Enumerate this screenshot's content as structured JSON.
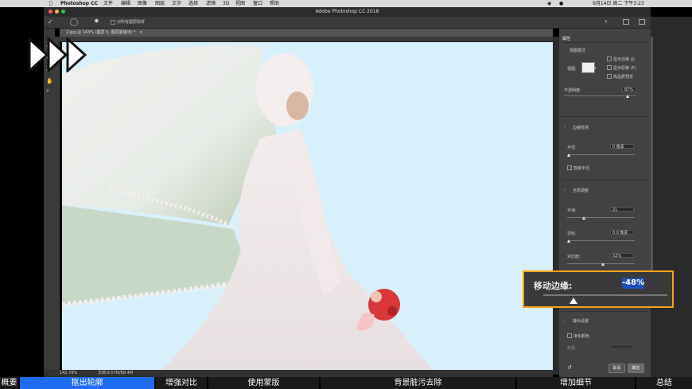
{
  "menubar": {
    "app_name": "Photoshop CC",
    "menus": [
      "文件",
      "编辑",
      "图像",
      "图层",
      "文字",
      "选择",
      "滤镜",
      "3D",
      "视图",
      "窗口",
      "帮助"
    ],
    "clock": "9月14日 周二 下午3:23"
  },
  "window": {
    "title": "Adobe Photoshop CC 2018"
  },
  "options_bar": {
    "sample_all_layers": "对所有图层取样"
  },
  "document_tab": {
    "label": "2.jpg @ 143% (图层 0, 图层蒙版/8) *",
    "close": "×"
  },
  "status": {
    "zoom": "142.78%",
    "doc_size": "文档:9.57M/68.4M"
  },
  "panel": {
    "header": "属性",
    "view_mode": {
      "title": "视图模式",
      "view_label": "视图:",
      "show_edge": "显示边缘 (J)",
      "show_original": "显示原稿 (P)",
      "hq_preview": "高品质预览"
    },
    "opacity": {
      "label": "不透明度:",
      "value": "87%",
      "level": 0.87
    },
    "edge_detection": {
      "title": "边缘检测",
      "radius_label": "半径:",
      "radius_value": "0 像素",
      "smart_radius": "智能半径"
    },
    "global": {
      "title": "全局调整",
      "smooth_label": "平滑:",
      "smooth_value": "21",
      "feather_label": "羽化:",
      "feather_value": "0.0 像素",
      "contrast_label": "对比度:",
      "contrast_value": "52%"
    },
    "output": {
      "title": "输出设置",
      "decontaminate": "净化颜色",
      "amount_label": "数量:"
    },
    "cancel": "取消",
    "ok": "确定"
  },
  "callout": {
    "label": "移动边缘:",
    "value": "-48%",
    "level": 0.26
  },
  "chapters": [
    {
      "label": "概要",
      "active": false
    },
    {
      "label": "抠出轮廓",
      "active": true
    },
    {
      "label": "增强对比",
      "active": false
    },
    {
      "label": "使用蒙版",
      "active": false
    },
    {
      "label": "背景脏污去除",
      "active": false
    },
    {
      "label": "增加细节",
      "active": false
    },
    {
      "label": "总结",
      "active": false
    }
  ],
  "colors": {
    "accent": "#1e6cf2",
    "callout_border": "#f4a31b",
    "canvas_bg": "#d8f0fb"
  }
}
